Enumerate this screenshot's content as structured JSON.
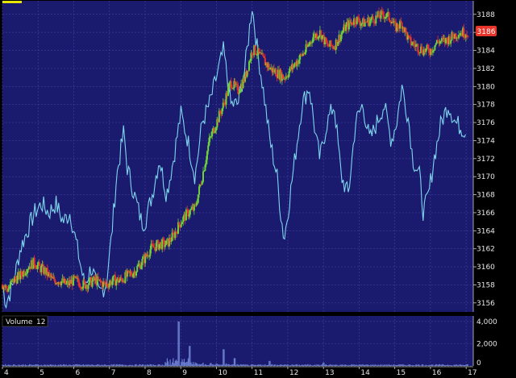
{
  "chart_data": [
    {
      "type": "candlestick",
      "title": "",
      "price_badge": "3186",
      "y_ticks": [
        "3156",
        "3158",
        "3160",
        "3162",
        "3164",
        "3166",
        "3168",
        "3170",
        "3172",
        "3174",
        "3176",
        "3178",
        "3180",
        "3182",
        "3184",
        "3186",
        "3188"
      ],
      "ylim": [
        3155,
        3189.5
      ],
      "x_ticks": [
        "4",
        "5",
        "6",
        "7",
        "8",
        "9",
        "10",
        "11",
        "12",
        "13",
        "14",
        "15",
        "16",
        "17"
      ],
      "xlim": [
        4,
        17.2
      ],
      "grid": true,
      "colors": {
        "background": "#1a1a6e",
        "grid": "#3d3d9a",
        "up": "#6fd23c",
        "down": "#e8352c",
        "overlay": "#7fd6ec",
        "badge": "#e8352c",
        "axis_text": "#e6e6e6"
      },
      "price_path": [
        [
          4.0,
          3158
        ],
        [
          4.15,
          3157.5
        ],
        [
          4.3,
          3158.5
        ],
        [
          4.5,
          3159
        ],
        [
          4.7,
          3160
        ],
        [
          4.9,
          3160.5
        ],
        [
          5.0,
          3160
        ],
        [
          5.2,
          3159.5
        ],
        [
          5.4,
          3158.5
        ],
        [
          5.6,
          3158.5
        ],
        [
          5.8,
          3158
        ],
        [
          6.0,
          3158.5
        ],
        [
          6.3,
          3158
        ],
        [
          6.6,
          3158.5
        ],
        [
          6.9,
          3158
        ],
        [
          7.1,
          3158.5
        ],
        [
          7.3,
          3158.5
        ],
        [
          7.5,
          3159
        ],
        [
          7.7,
          3159.5
        ],
        [
          7.9,
          3160.5
        ],
        [
          8.0,
          3161
        ],
        [
          8.15,
          3162
        ],
        [
          8.4,
          3162.5
        ],
        [
          8.6,
          3162.5
        ],
        [
          8.8,
          3163.5
        ],
        [
          9.0,
          3165
        ],
        [
          9.2,
          3166
        ],
        [
          9.4,
          3166.5
        ],
        [
          9.6,
          3170
        ],
        [
          9.8,
          3174
        ],
        [
          10.0,
          3176
        ],
        [
          10.2,
          3178
        ],
        [
          10.4,
          3180.5
        ],
        [
          10.6,
          3179.5
        ],
        [
          10.8,
          3181
        ],
        [
          11.0,
          3184
        ],
        [
          11.1,
          3184
        ],
        [
          11.3,
          3183
        ],
        [
          11.5,
          3182
        ],
        [
          11.7,
          3181.5
        ],
        [
          11.9,
          3181
        ],
        [
          12.1,
          3182
        ],
        [
          12.3,
          3183
        ],
        [
          12.5,
          3184
        ],
        [
          12.7,
          3185.5
        ],
        [
          12.9,
          3186
        ],
        [
          13.1,
          3184.5
        ],
        [
          13.3,
          3184.5
        ],
        [
          13.6,
          3186.5
        ],
        [
          13.9,
          3187.5
        ],
        [
          14.1,
          3187
        ],
        [
          14.4,
          3187.5
        ],
        [
          14.7,
          3188
        ],
        [
          14.9,
          3187.5
        ],
        [
          15.0,
          3186.5
        ],
        [
          15.2,
          3187
        ],
        [
          15.4,
          3185
        ],
        [
          15.6,
          3184.5
        ],
        [
          15.8,
          3184
        ],
        [
          16.0,
          3184
        ],
        [
          16.2,
          3185
        ],
        [
          16.4,
          3185
        ],
        [
          16.6,
          3185.5
        ],
        [
          16.8,
          3186
        ],
        [
          17.0,
          3186
        ]
      ],
      "overlay_path": [
        [
          4.0,
          3158
        ],
        [
          4.1,
          3156
        ],
        [
          4.3,
          3158
        ],
        [
          4.5,
          3162
        ],
        [
          4.7,
          3164
        ],
        [
          4.9,
          3166
        ],
        [
          5.1,
          3167
        ],
        [
          5.3,
          3166
        ],
        [
          5.5,
          3167
        ],
        [
          5.7,
          3165
        ],
        [
          5.9,
          3166
        ],
        [
          6.1,
          3162
        ],
        [
          6.3,
          3158
        ],
        [
          6.5,
          3160
        ],
        [
          6.7,
          3157
        ],
        [
          6.9,
          3158
        ],
        [
          7.05,
          3163
        ],
        [
          7.2,
          3170
        ],
        [
          7.4,
          3175
        ],
        [
          7.5,
          3171
        ],
        [
          7.7,
          3168
        ],
        [
          7.9,
          3165
        ],
        [
          8.0,
          3165
        ],
        [
          8.2,
          3168
        ],
        [
          8.4,
          3172
        ],
        [
          8.6,
          3168
        ],
        [
          8.8,
          3172
        ],
        [
          9.0,
          3177
        ],
        [
          9.2,
          3174
        ],
        [
          9.4,
          3170
        ],
        [
          9.6,
          3176
        ],
        [
          9.8,
          3178
        ],
        [
          10.0,
          3181
        ],
        [
          10.2,
          3184
        ],
        [
          10.4,
          3178
        ],
        [
          10.6,
          3178
        ],
        [
          10.8,
          3182
        ],
        [
          11.0,
          3189
        ],
        [
          11.15,
          3184
        ],
        [
          11.3,
          3180
        ],
        [
          11.5,
          3174
        ],
        [
          11.7,
          3170
        ],
        [
          11.8,
          3166
        ],
        [
          11.9,
          3163
        ],
        [
          12.0,
          3166
        ],
        [
          12.2,
          3172
        ],
        [
          12.4,
          3178
        ],
        [
          12.6,
          3180
        ],
        [
          12.8,
          3174
        ],
        [
          12.9,
          3172
        ],
        [
          13.1,
          3176
        ],
        [
          13.3,
          3178
        ],
        [
          13.5,
          3170
        ],
        [
          13.7,
          3168
        ],
        [
          13.9,
          3176
        ],
        [
          14.1,
          3178
        ],
        [
          14.3,
          3174
        ],
        [
          14.5,
          3176
        ],
        [
          14.7,
          3178
        ],
        [
          14.9,
          3174
        ],
        [
          15.05,
          3176
        ],
        [
          15.2,
          3180
        ],
        [
          15.4,
          3176
        ],
        [
          15.5,
          3172
        ],
        [
          15.7,
          3170
        ],
        [
          15.8,
          3166
        ],
        [
          15.95,
          3168
        ],
        [
          16.1,
          3172
        ],
        [
          16.3,
          3176
        ],
        [
          16.5,
          3178
        ],
        [
          16.7,
          3176
        ],
        [
          17.0,
          3175
        ]
      ]
    },
    {
      "type": "bar",
      "title": "Volume",
      "badge": "12",
      "y_ticks": [
        "4,000",
        "2,000",
        "0"
      ],
      "ylim": [
        0,
        4500
      ],
      "spikes": [
        [
          8.95,
          4000
        ],
        [
          9.25,
          1800
        ],
        [
          10.2,
          1500
        ],
        [
          10.5,
          700
        ],
        [
          11.5,
          450
        ],
        [
          13.0,
          300
        ]
      ],
      "base_level": 120
    }
  ]
}
